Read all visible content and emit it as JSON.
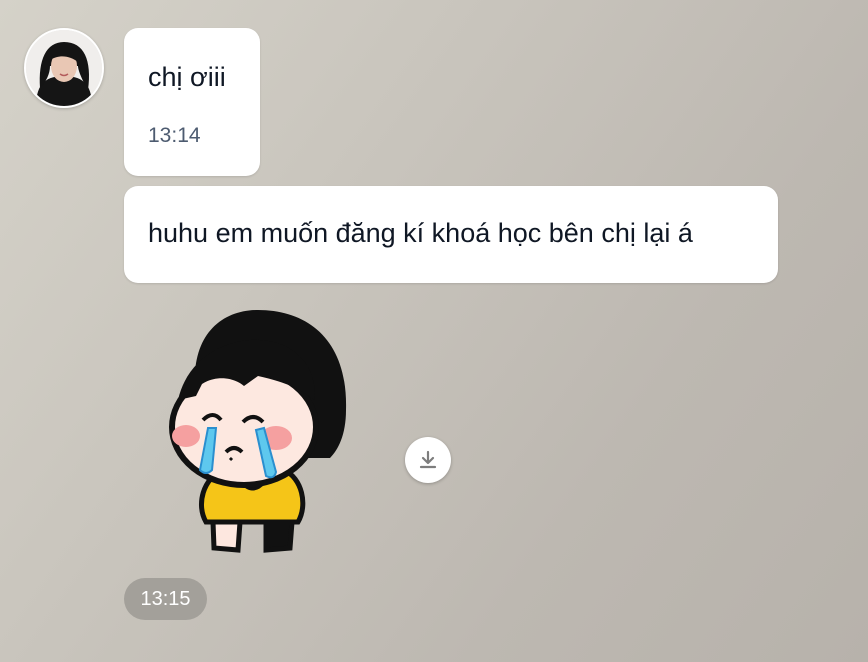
{
  "sender": {
    "avatar_icon": "user-avatar-photo"
  },
  "messages": [
    {
      "type": "text",
      "text": "chị ơiii",
      "time": "13:14"
    },
    {
      "type": "text",
      "text": "huhu em muốn đăng kí khoá học bên chị lại á"
    },
    {
      "type": "sticker",
      "sticker_icon": "crying-girl-sticker",
      "time": "13:15"
    }
  ],
  "actions": {
    "download_icon": "download-icon"
  },
  "colors": {
    "bubble": "#ffffff",
    "text": "#0f1724",
    "time_text": "#4d5b70",
    "time_pill": "#a3a09a"
  }
}
